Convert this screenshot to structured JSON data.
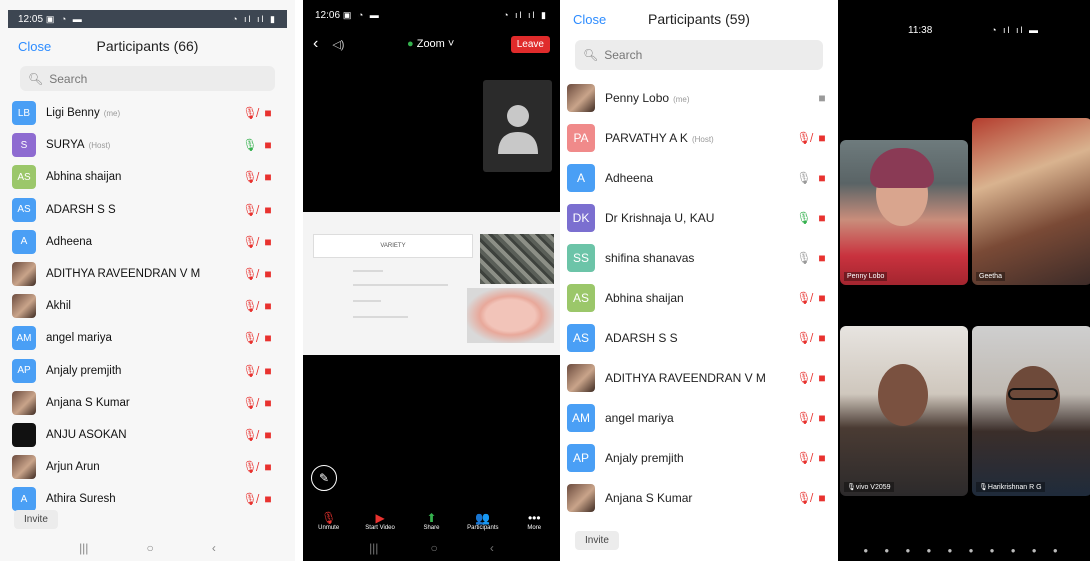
{
  "panel1": {
    "status_time": "12:05",
    "status_left_icons": "▣ ◔ ▬",
    "status_right_icons": "◔ ıl ıl ▮",
    "close_label": "Close",
    "title": "Participants (66)",
    "search_placeholder": "Search",
    "participants": [
      {
        "initials": "LB",
        "name": "Ligi Benny",
        "tag": "(me)",
        "avatar_color": "#4a9ff5",
        "mic": "muted",
        "cam": "off"
      },
      {
        "initials": "S",
        "name": "SURYA",
        "tag": "(Host)",
        "avatar_color": "#8e6bd1",
        "mic": "on",
        "cam": "off"
      },
      {
        "initials": "AS",
        "name": "Abhina shaijan",
        "tag": "",
        "avatar_color": "#9bc76a",
        "mic": "muted",
        "cam": "off"
      },
      {
        "initials": "AS",
        "name": "ADARSH S S",
        "tag": "",
        "avatar_color": "#4a9ff5",
        "mic": "muted",
        "cam": "off"
      },
      {
        "initials": "A",
        "name": "Adheena",
        "tag": "",
        "avatar_color": "#4a9ff5",
        "mic": "muted",
        "cam": "off"
      },
      {
        "initials": "",
        "name": "ADITHYA RAVEENDRAN V M",
        "tag": "",
        "avatar_color": "photo",
        "mic": "muted",
        "cam": "off"
      },
      {
        "initials": "",
        "name": "Akhil",
        "tag": "",
        "avatar_color": "photo",
        "mic": "muted",
        "cam": "off"
      },
      {
        "initials": "AM",
        "name": "angel mariya",
        "tag": "",
        "avatar_color": "#4a9ff5",
        "mic": "muted",
        "cam": "off"
      },
      {
        "initials": "AP",
        "name": "Anjaly premjith",
        "tag": "",
        "avatar_color": "#4a9ff5",
        "mic": "muted",
        "cam": "off"
      },
      {
        "initials": "",
        "name": "Anjana S Kumar",
        "tag": "",
        "avatar_color": "photo",
        "mic": "muted",
        "cam": "off"
      },
      {
        "initials": "",
        "name": "ANJU ASOKAN",
        "tag": "",
        "avatar_color": "black",
        "mic": "muted",
        "cam": "off"
      },
      {
        "initials": "",
        "name": "Arjun Arun",
        "tag": "",
        "avatar_color": "photo",
        "mic": "muted",
        "cam": "off"
      },
      {
        "initials": "A",
        "name": "Athira Suresh",
        "tag": "",
        "avatar_color": "#4a9ff5",
        "mic": "muted",
        "cam": "off"
      }
    ],
    "invite_label": "Invite"
  },
  "panel2": {
    "status_time": "12:06",
    "status_left_icons": "▣ ◔ ▬",
    "status_right_icons": "◔ ıl ıl ▮",
    "zoom_label": "Zoom",
    "leave_label": "Leave",
    "slide_title": "VARIETY",
    "toolbar": [
      {
        "icon": "mic-muted",
        "glyph": "🎙",
        "label": "Unmute",
        "style": "red"
      },
      {
        "icon": "video-off",
        "glyph": "▶",
        "label": "Start Video",
        "style": "red"
      },
      {
        "icon": "share",
        "glyph": "⬆",
        "label": "Share",
        "style": "green"
      },
      {
        "icon": "participants",
        "glyph": "👥",
        "label": "Participants",
        "style": ""
      },
      {
        "icon": "more",
        "glyph": "•••",
        "label": "More",
        "style": ""
      }
    ]
  },
  "panel3": {
    "close_label": "Close",
    "title": "Participants (59)",
    "search_placeholder": "Search",
    "participants": [
      {
        "initials": "",
        "name": "Penny Lobo",
        "tag": "(me)",
        "avatar_color": "photo",
        "mic": "none",
        "cam": "idle"
      },
      {
        "initials": "PA",
        "name": "PARVATHY A K",
        "tag": "(Host)",
        "avatar_color": "#f08a8a",
        "mic": "muted",
        "cam": "off"
      },
      {
        "initials": "A",
        "name": "Adheena",
        "tag": "",
        "avatar_color": "#4a9ff5",
        "mic": "idle",
        "cam": "off"
      },
      {
        "initials": "DK",
        "name": "Dr Krishnaja U, KAU",
        "tag": "",
        "avatar_color": "#7b6fd0",
        "mic": "on",
        "cam": "off"
      },
      {
        "initials": "SS",
        "name": "shifina shanavas",
        "tag": "",
        "avatar_color": "#6cc4a8",
        "mic": "idle",
        "cam": "off"
      },
      {
        "initials": "AS",
        "name": "Abhina shaijan",
        "tag": "",
        "avatar_color": "#9bc76a",
        "mic": "muted",
        "cam": "off"
      },
      {
        "initials": "AS",
        "name": "ADARSH S S",
        "tag": "",
        "avatar_color": "#4a9ff5",
        "mic": "muted",
        "cam": "off"
      },
      {
        "initials": "",
        "name": "ADITHYA RAVEENDRAN V M",
        "tag": "",
        "avatar_color": "photo",
        "mic": "muted",
        "cam": "off"
      },
      {
        "initials": "AM",
        "name": "angel mariya",
        "tag": "",
        "avatar_color": "#4a9ff5",
        "mic": "muted",
        "cam": "off"
      },
      {
        "initials": "AP",
        "name": "Anjaly premjith",
        "tag": "",
        "avatar_color": "#4a9ff5",
        "mic": "muted",
        "cam": "off"
      },
      {
        "initials": "",
        "name": "Anjana S Kumar",
        "tag": "",
        "avatar_color": "photo",
        "mic": "muted",
        "cam": "off"
      }
    ],
    "invite_label": "Invite"
  },
  "panel4": {
    "status_time": "11:38",
    "status_right_icons": "◔ ıl ıl ▬",
    "tiles": [
      {
        "name": "Penny Lobo"
      },
      {
        "name": "Geetha"
      },
      {
        "name": "vivo V2059"
      },
      {
        "name": "Harikrishnan R G"
      }
    ],
    "page_dots": "● ● ● ● ● ● ● ● ● ●"
  }
}
